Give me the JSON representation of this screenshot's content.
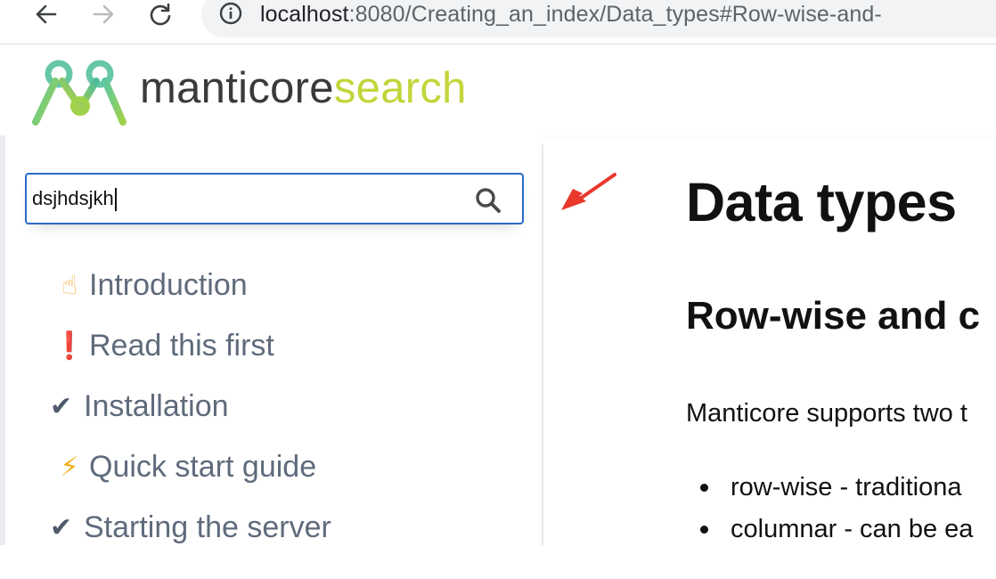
{
  "browser": {
    "url_host": "localhost",
    "url_path": ":8080/Creating_an_index/Data_types#Row-wise-and-"
  },
  "logo": {
    "part1": "manticore",
    "part2": "search",
    "brand_colors": [
      "#4cbf8a",
      "#c2d53a",
      "#3a3a3a"
    ]
  },
  "search": {
    "value": "dsjhdsjkh"
  },
  "sidebar": {
    "items": [
      {
        "icon": "point-up-emoji",
        "glyph": "☝",
        "label": "Introduction"
      },
      {
        "icon": "exclamation-emoji",
        "glyph": "❗",
        "label": "Read this first"
      },
      {
        "icon": "check-icon",
        "glyph": "✔",
        "label": "Installation"
      },
      {
        "icon": "lightning-icon",
        "glyph": "⚡",
        "label": "Quick start guide"
      },
      {
        "icon": "check-icon",
        "glyph": "✔",
        "label": "Starting the server"
      }
    ]
  },
  "content": {
    "title": "Data types",
    "subtitle": "Row-wise and c",
    "paragraph": "Manticore supports two t",
    "bullets": [
      "row-wise - traditiona",
      "columnar - can be ea"
    ]
  },
  "annotation": {
    "arrow_color": "#e8372b"
  }
}
